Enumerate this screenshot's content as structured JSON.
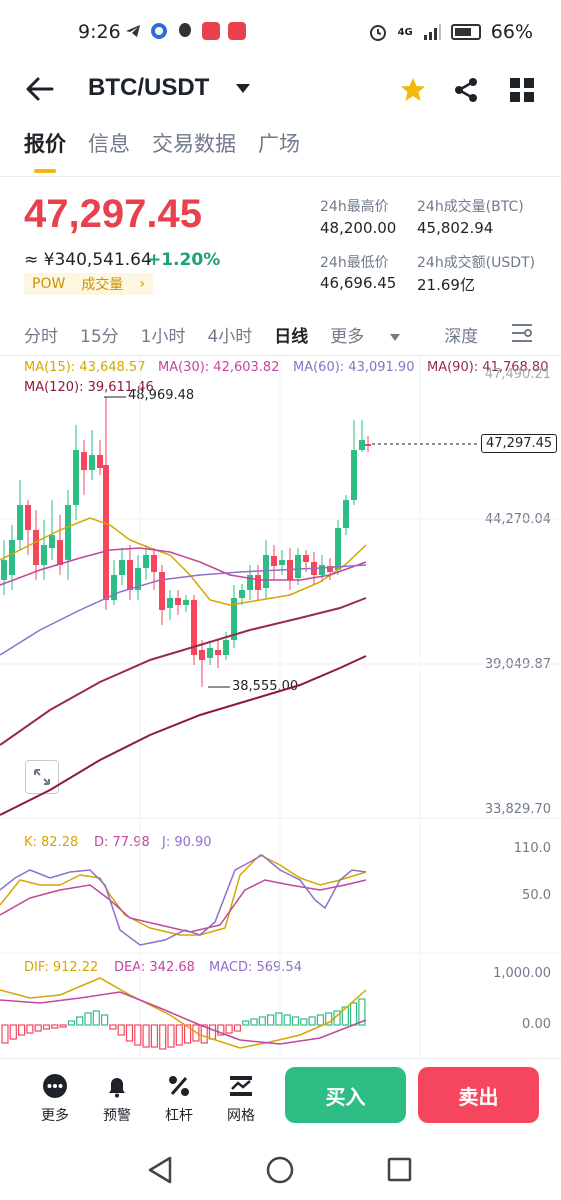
{
  "status": {
    "time": "9:26",
    "signal": "4G",
    "battery": "66%"
  },
  "header": {
    "pair": "BTC/USDT"
  },
  "tabs": [
    "报价",
    "信息",
    "交易数据",
    "广场"
  ],
  "quote": {
    "price": "47,297.45",
    "cny": "≈ ¥340,541.64",
    "change": "+1.20%",
    "tag_pow": "POW",
    "tag_volume": "成交量",
    "tag_arrow": "›",
    "stats": [
      {
        "label": "24h最高价",
        "value": "48,200.00"
      },
      {
        "label": "24h成交量(BTC)",
        "value": "45,802.94"
      },
      {
        "label": "24h最低价",
        "value": "46,696.45"
      },
      {
        "label": "24h成交额(USDT)",
        "value": "21.69亿"
      }
    ]
  },
  "timeframes": [
    "分时",
    "15分",
    "1小时",
    "4小时",
    "日线",
    "更多",
    "深度"
  ],
  "ma": {
    "ma15": "MA(15): 43,648.57",
    "ma30": "MA(30): 42,603.82",
    "ma60": "MA(60): 43,091.90",
    "ma90": "MA(90): 41,768.80",
    "ma120": "MA(120): 39,611.46"
  },
  "axis": {
    "p1": "47,490.21",
    "p2": "44,270.04",
    "p3": "39,049.87",
    "p4": "33,829.70",
    "kdj_top": "110.0",
    "kdj_mid": "50.0",
    "macd_top": "1,000.00",
    "macd_zero": "0.00"
  },
  "annotations": {
    "high": "48,969.48",
    "low": "38,555.00",
    "last": "47,297.45"
  },
  "kdj": {
    "k": "K: 82.28",
    "d": "D: 77.98",
    "j": "J: 90.90"
  },
  "macd": {
    "dif": "DIF: 912.22",
    "dea": "DEA: 342.68",
    "macd": "MACD: 569.54"
  },
  "bottom": {
    "more": "更多",
    "alert": "预警",
    "leverage": "杠杆",
    "grid": "网格",
    "buy": "买入",
    "sell": "卖出"
  },
  "colors": {
    "up": "#2ebd85",
    "down": "#f6465d",
    "accent": "#f0b90b"
  }
}
